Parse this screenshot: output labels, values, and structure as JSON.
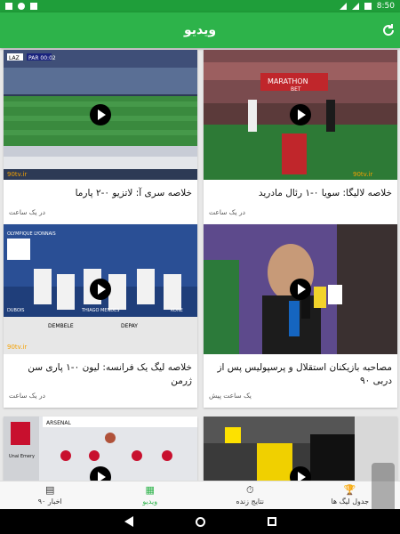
{
  "statusbar": {
    "time": "8:50"
  },
  "appbar": {
    "title": "ویدیو"
  },
  "cards": [
    {
      "title": "خلاصه سری آ: لاتزیو ۰-۲ پارما",
      "time": "در یک ساعت"
    },
    {
      "title": "خلاصه لالیگا: سویا ۰-۱ رئال مادرید",
      "time": "در یک ساعت"
    },
    {
      "title": "خلاصه لیگ یک فرانسه: لیون ۰-۱ پاری سن ژرمن",
      "time": "در یک ساعت"
    },
    {
      "title": "مصاحبه بازیکنان استقلال و پرسپولیس پس از دربی ۹۰",
      "time": "یک ساعت پیش"
    },
    {
      "title": "",
      "time": ""
    },
    {
      "title": "",
      "time": ""
    }
  ],
  "thumbs": {
    "scoreboard": "PAR 00:02",
    "home_team": "LAZ",
    "sponsor_1": "MARATHON",
    "sponsor_2": "BET",
    "watermark_90tv": "90tv.ir",
    "lineup_title": "OLYMPIQUE LYONNAIS",
    "player_1": "DEMBELE",
    "player_2": "DEPAY",
    "player_3": "DUBOIS",
    "player_4": "THIAGO MENDES",
    "player_5": "KONE",
    "arsenal_title": "ARSENAL",
    "coach": "Unai Emery"
  },
  "bottom_nav": [
    {
      "label": "جدول لیگ ها",
      "icon": "trophy-icon"
    },
    {
      "label": "نتایج زنده",
      "icon": "stopwatch-icon"
    },
    {
      "label": "ویدیو",
      "icon": "film-icon",
      "active": true
    },
    {
      "label": "اخبار ۹۰",
      "icon": "newspaper-icon"
    }
  ],
  "colors": {
    "appbar": "#2db34a",
    "statusbar": "#1f9e3a",
    "active_tab": "#2db34a"
  }
}
